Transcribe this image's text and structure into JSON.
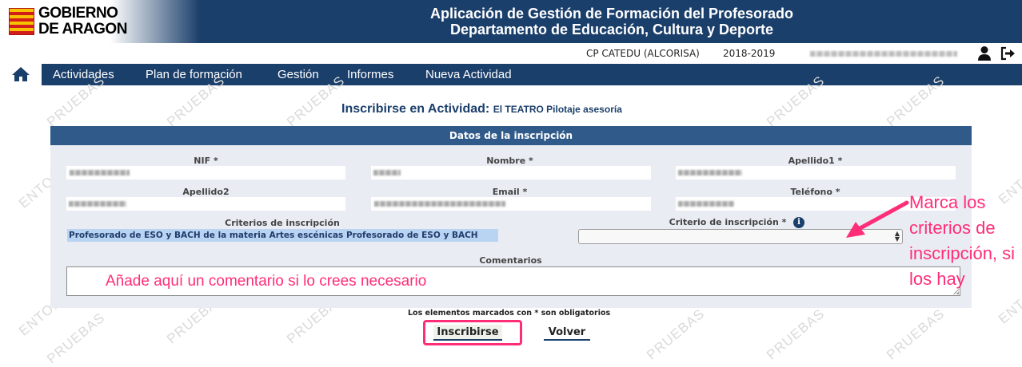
{
  "header": {
    "logo_text_line1": "GOBIERNO",
    "logo_text_line2": "DE ARAGON",
    "title_line1": "Aplicación de Gestión de Formación del Profesorado",
    "title_line2": "Departamento de Educación, Cultura y Deporte"
  },
  "infobar": {
    "center": "CP CATEDU (ALCORISA)",
    "course": "2018-2019",
    "user_icon": "user-icon",
    "logout_icon": "logout-icon"
  },
  "nav": {
    "home_icon": "home-icon",
    "items": [
      {
        "label": "Actividades"
      },
      {
        "label": "Plan de formación"
      },
      {
        "label": "Gestión"
      },
      {
        "label": "Informes"
      },
      {
        "label": "Nueva Actividad"
      }
    ]
  },
  "watermark": {
    "word1": "PRUEBAS",
    "word2": "ENTORNO"
  },
  "page": {
    "title": "Inscribirse en Actividad:",
    "activity": "El TEATRO Pilotaje asesoría"
  },
  "form": {
    "section_title": "Datos de la inscripción",
    "labels": {
      "nif": "NIF *",
      "nombre": "Nombre *",
      "apellido1": "Apellido1 *",
      "apellido2": "Apellido2",
      "email": "Email *",
      "telefono": "Teléfono *",
      "criterios": "Criterios de inscripción",
      "criterio": "Criterio de inscripción *",
      "comentarios": "Comentarios"
    },
    "criterios_value": "Profesorado de ESO y BACH de la materia Artes escénicas Profesorado de ESO y BACH",
    "criterio_selected": "",
    "info_icon": "i",
    "required_note": "Los elementos marcados con * son obligatorios"
  },
  "buttons": {
    "inscribirse": "Inscribirse",
    "volver": "Volver"
  },
  "annotations": {
    "comment_hint": "Añade aquí un comentario si lo crees necesario",
    "criteria_hint": "Marca los criterios de inscripción, si los hay",
    "color": "#ff2d78"
  }
}
